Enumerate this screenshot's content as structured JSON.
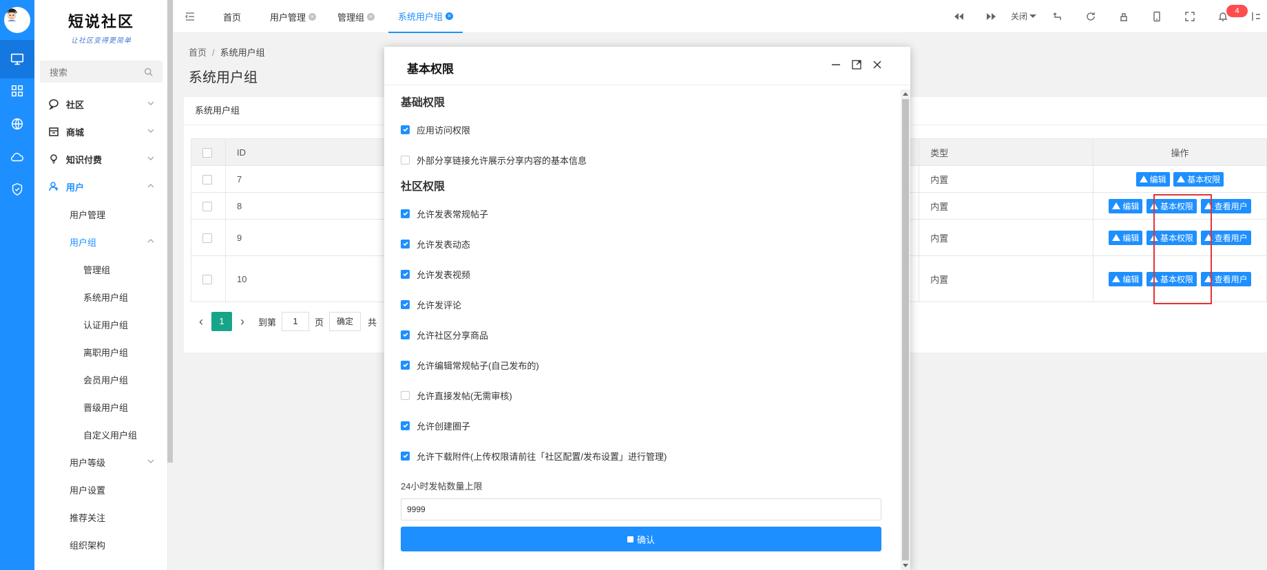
{
  "app": {
    "logo_title": "短说社区",
    "logo_slogan": "让社区变得更简单"
  },
  "rail": {
    "icons": [
      "monitor-icon",
      "grid-icon",
      "globe-icon",
      "cloud-icon",
      "shield-icon"
    ]
  },
  "sidebar": {
    "search_label": "搜索",
    "items": [
      {
        "label": "社区",
        "icon": "chat-icon"
      },
      {
        "label": "商城",
        "icon": "store-icon"
      },
      {
        "label": "知识付费",
        "icon": "bulb-icon"
      },
      {
        "label": "用户",
        "icon": "user-icon"
      }
    ],
    "user_sub": {
      "manage": "用户管理",
      "group": "用户组",
      "group_children": [
        "管理组",
        "系统用户组",
        "认证用户组",
        "离职用户组",
        "会员用户组",
        "晋级用户组",
        "自定义用户组"
      ],
      "level": "用户等级",
      "settings": "用户设置",
      "follow": "推荐关注",
      "org": "组织架构"
    }
  },
  "topbar": {
    "tabs": [
      "首页",
      "用户管理",
      "管理组",
      "系统用户组"
    ],
    "close_label": "关闭",
    "notification_count": "4"
  },
  "breadcrumb": {
    "home": "首页",
    "sep": "/",
    "current": "系统用户组"
  },
  "page": {
    "title": "系统用户组",
    "card_title": "系统用户组"
  },
  "table": {
    "headers": {
      "id": "ID",
      "type": "类型",
      "ops": "操作"
    },
    "rows": [
      {
        "id": "7",
        "type": "内置"
      },
      {
        "id": "8",
        "type": "内置"
      },
      {
        "id": "9",
        "type": "内置"
      },
      {
        "id": "10",
        "type": "内置"
      }
    ],
    "btn_edit": "编辑",
    "btn_perm": "基本权限",
    "btn_users": "查看用户"
  },
  "pager": {
    "current_page": "1",
    "goto_label": "到第",
    "goto_value": "1",
    "page_unit": "页",
    "confirm": "确定",
    "total_prefix": "共"
  },
  "modal": {
    "title": "基本权限",
    "section_basic": "基础权限",
    "basic_perms": [
      {
        "label": "应用访问权限",
        "checked": true
      },
      {
        "label": "外部分享链接允许展示分享内容的基本信息",
        "checked": false
      }
    ],
    "section_community": "社区权限",
    "community_perms": [
      {
        "label": "允许发表常规帖子",
        "checked": true
      },
      {
        "label": "允许发表动态",
        "checked": true
      },
      {
        "label": "允许发表视频",
        "checked": true
      },
      {
        "label": "允许发评论",
        "checked": true
      },
      {
        "label": "允许社区分享商品",
        "checked": true
      },
      {
        "label": "允许编辑常规帖子(自己发布的)",
        "checked": true
      },
      {
        "label": "允许直接发帖(无需审核)",
        "checked": false
      },
      {
        "label": "允许创建圈子",
        "checked": true
      },
      {
        "label": "允许下载附件(上传权限请前往「社区配置/发布设置」进行管理)",
        "checked": true
      }
    ],
    "limit_label": "24小时发帖数量上限",
    "limit_value": "9999",
    "confirm_label": "确认"
  },
  "colors": {
    "primary": "#1e8fff",
    "pager_active": "#17a589",
    "highlight_box": "#e03333"
  }
}
